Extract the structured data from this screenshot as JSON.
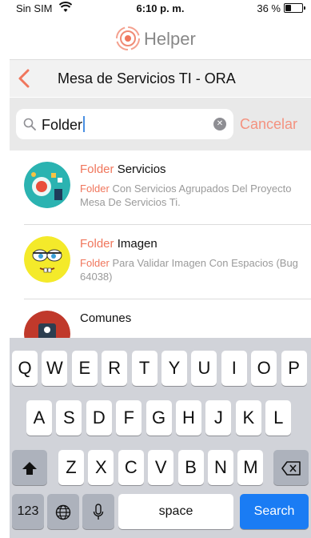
{
  "status": {
    "carrier": "Sin SIM",
    "time": "6:10 p. m.",
    "battery": "36 %",
    "battery_level": 0.36
  },
  "app": {
    "name": "Helper"
  },
  "nav": {
    "title": "Mesa de Servicios TI - ORA"
  },
  "search": {
    "value": "Folder",
    "cancel_label": "Cancelar"
  },
  "results": [
    {
      "title_match": "Folder",
      "title_rest": " Servicios",
      "desc_match": "Folder",
      "desc_rest": " Con Servicios Agrupados Del Proyecto Mesa De Servicios Ti."
    },
    {
      "title_match": "Folder",
      "title_rest": " Imagen",
      "desc_match": "Folder",
      "desc_rest": " Para Validar Imagen Con Espacios (Bug 64038)"
    },
    {
      "title_match": "",
      "title_rest": "Comunes",
      "desc_match": "",
      "desc_rest": ""
    }
  ],
  "keyboard": {
    "row1": [
      "Q",
      "W",
      "E",
      "R",
      "T",
      "Y",
      "U",
      "I",
      "O",
      "P"
    ],
    "row2": [
      "A",
      "S",
      "D",
      "F",
      "G",
      "H",
      "J",
      "K",
      "L"
    ],
    "row3": [
      "Z",
      "X",
      "C",
      "V",
      "B",
      "N",
      "M"
    ],
    "numbers_label": "123",
    "space_label": "space",
    "search_label": "Search"
  },
  "colors": {
    "accent": "#f0765c",
    "search_key": "#1a7cf4"
  }
}
